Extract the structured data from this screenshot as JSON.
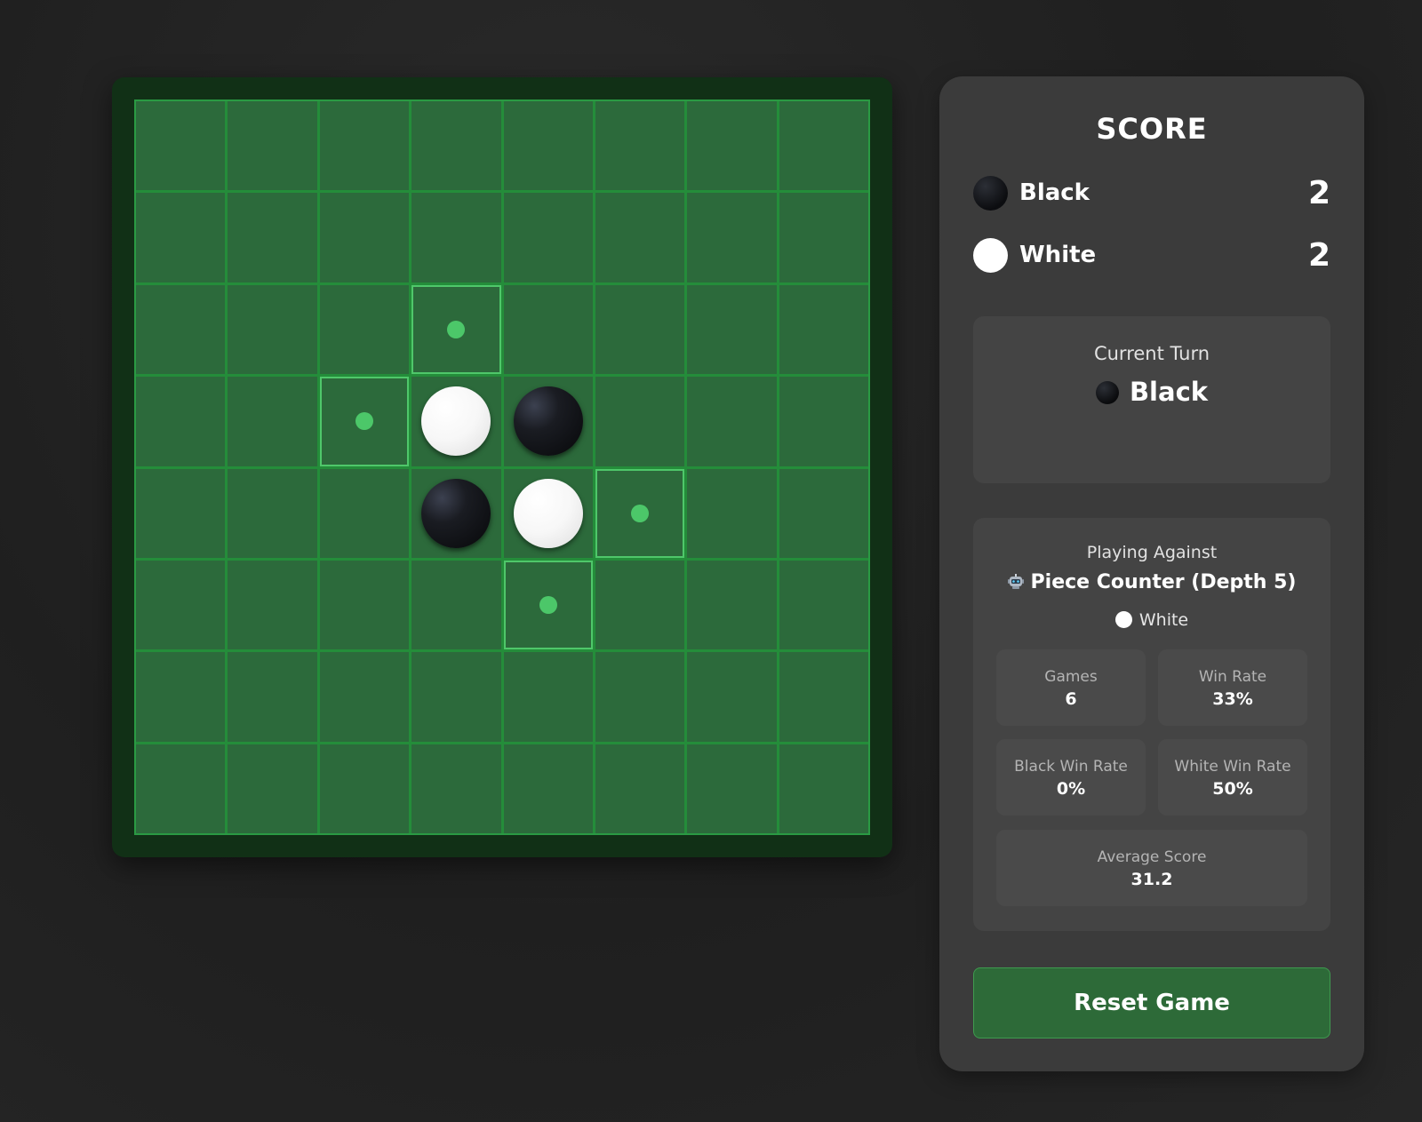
{
  "board": {
    "size": 8,
    "cells": [
      [
        0,
        0,
        0,
        0,
        0,
        0,
        0,
        0
      ],
      [
        0,
        0,
        0,
        0,
        0,
        0,
        0,
        0
      ],
      [
        0,
        0,
        0,
        "v",
        0,
        0,
        0,
        0
      ],
      [
        0,
        0,
        "v",
        "W",
        "B",
        0,
        0,
        0
      ],
      [
        0,
        0,
        0,
        "B",
        "W",
        "v",
        0,
        0
      ],
      [
        0,
        0,
        0,
        0,
        "v",
        0,
        0,
        0
      ],
      [
        0,
        0,
        0,
        0,
        0,
        0,
        0,
        0
      ],
      [
        0,
        0,
        0,
        0,
        0,
        0,
        0,
        0
      ]
    ]
  },
  "score": {
    "title": "SCORE",
    "black": {
      "label": "Black",
      "value": "2"
    },
    "white": {
      "label": "White",
      "value": "2"
    }
  },
  "turn": {
    "label": "Current Turn",
    "player": "Black"
  },
  "opponent": {
    "label": "Playing Against",
    "icon": "robot-icon",
    "name": "Piece Counter (Depth 5)",
    "color": "White",
    "stats": {
      "games_label": "Games",
      "games": "6",
      "win_rate_label": "Win Rate",
      "win_rate": "33%",
      "black_win_rate_label": "Black Win Rate",
      "black_win_rate": "0%",
      "white_win_rate_label": "White Win Rate",
      "white_win_rate": "50%",
      "avg_score_label": "Average Score",
      "avg_score": "31.2"
    }
  },
  "reset_label": "Reset Game",
  "colors": {
    "board": "#2c6a3b",
    "grid": "#248d3a",
    "frame": "#113016",
    "hint": "#4cc769",
    "panel": "#3b3b3b",
    "button": "#2d6a38"
  }
}
